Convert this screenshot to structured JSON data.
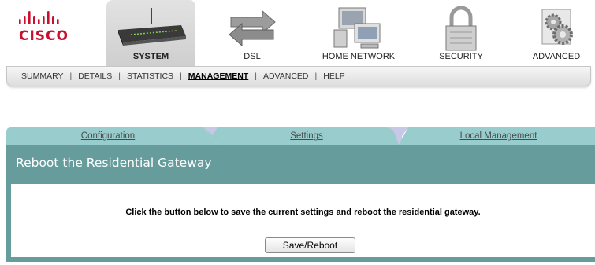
{
  "brand": {
    "logo_text": "CISCO"
  },
  "nav": {
    "tabs": [
      {
        "label": "SYSTEM",
        "icon": "router-icon",
        "active": true
      },
      {
        "label": "DSL",
        "icon": "arrows-icon",
        "active": false
      },
      {
        "label": "HOME NETWORK",
        "icon": "computers-icon",
        "active": false
      },
      {
        "label": "SECURITY",
        "icon": "padlock-icon",
        "active": false
      },
      {
        "label": "ADVANCED",
        "icon": "gears-icon",
        "active": false
      }
    ]
  },
  "subnav": {
    "items": [
      {
        "label": "SUMMARY",
        "selected": false
      },
      {
        "label": "DETAILS",
        "selected": false
      },
      {
        "label": "STATISTICS",
        "selected": false
      },
      {
        "label": "MANAGEMENT",
        "selected": true
      },
      {
        "label": "ADVANCED",
        "selected": false
      },
      {
        "label": "HELP",
        "selected": false
      }
    ]
  },
  "content": {
    "tabs": [
      {
        "label": "Configuration"
      },
      {
        "label": "Settings"
      },
      {
        "label": "Local Management"
      }
    ],
    "title": "Reboot the Residential Gateway",
    "message": "Click the button below to save the current settings and reboot the residential gateway.",
    "button_label": "Save/Reboot"
  },
  "colors": {
    "panel_teal": "#669c9c",
    "tab_teal": "#99cccc",
    "tab_lavender": "#c7c7e6",
    "cisco_red": "#c8102e"
  }
}
